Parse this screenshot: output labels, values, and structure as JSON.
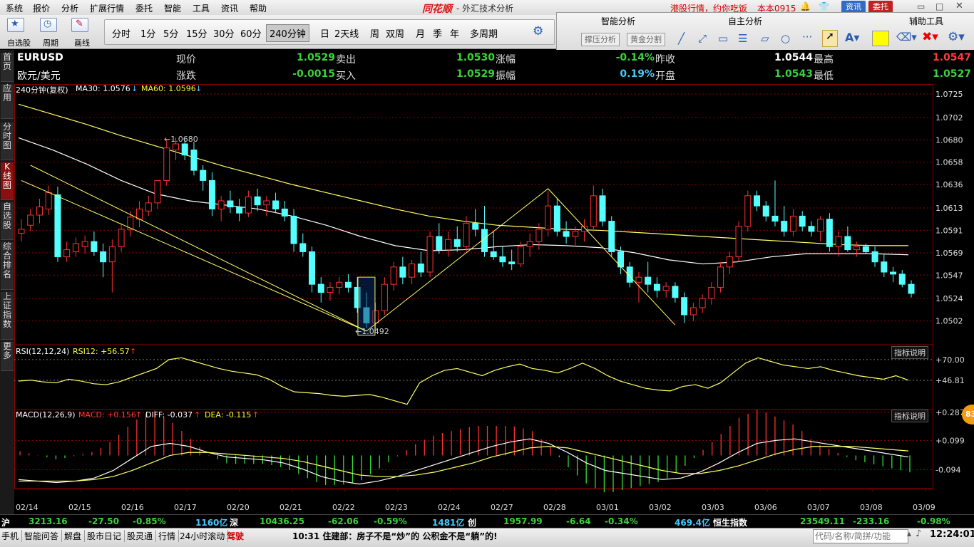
{
  "menu": [
    "系统",
    "报价",
    "分析",
    "扩展行情",
    "委托",
    "智能",
    "工具",
    "资讯",
    "帮助"
  ],
  "brand": "同花顺",
  "brand_sub": "- 外汇技术分析",
  "promo": "港股行情，约你吃饭",
  "account": "本本0915",
  "top_buttons": {
    "news": "资讯",
    "trade": "委托"
  },
  "toolbar": {
    "select_stock": "自选股",
    "period": "周期",
    "draw": "画线"
  },
  "periods": [
    "分时",
    "1分",
    "5分",
    "15分",
    "30分",
    "60分",
    "240分钟",
    "日",
    "2天线",
    "周",
    "双周",
    "月",
    "季",
    "年",
    "多周期"
  ],
  "analysis": {
    "smart": "智能分析",
    "selfselect": "自主分析",
    "aux": "辅助工具",
    "pressure_btn": "撑压分析",
    "golden_btn": "黄金分割"
  },
  "left_nav": [
    "首页",
    "应用",
    "分时图",
    "K线图",
    "自选股",
    "综合排名",
    "上证指数",
    "更多"
  ],
  "quote": {
    "code": "EURUSD",
    "name": "欧元/美元",
    "labels": {
      "now": "现价",
      "sell": "卖出",
      "change_pct": "涨幅",
      "prev_close": "昨收",
      "high": "最高",
      "change": "涨跌",
      "buy": "买入",
      "amplitude": "振幅",
      "open": "开盘",
      "low": "最低"
    },
    "now": "1.0529",
    "sell": "1.0530",
    "change_pct": "-0.14%",
    "prev_close": "1.0544",
    "high": "1.0547",
    "change": "-0.0015",
    "buy": "1.0529",
    "amplitude": "0.19%",
    "open": "1.0543",
    "low": "1.0527"
  },
  "indicators": {
    "main_title": "240分钟(复权)",
    "ma30": "MA30: 1.0576",
    "ma60": "MA60: 1.0596",
    "rsi_title": "RSI(12,12,24)",
    "rsi12": "RSI12: +56.57",
    "macd_title": "MACD(12,26,9)",
    "macd": "MACD: +0.156",
    "diff": "DIFF: -0.037",
    "dea": "DEA: -0.115",
    "explain": "指标说明",
    "high_label": "1.0680",
    "low_label": "1.0492",
    "badge": "83"
  },
  "chart_data": {
    "type": "candlestick",
    "price_axis": [
      "1.0725",
      "1.0702",
      "1.0680",
      "1.0658",
      "1.0636",
      "1.0613",
      "1.0591",
      "1.0569",
      "1.0547",
      "1.0524",
      "1.0502"
    ],
    "ylim": [
      1.048,
      1.0725
    ],
    "rsi_axis": [
      "+70.00",
      "+46.81"
    ],
    "rsi_ylim": [
      15,
      85
    ],
    "macd_axis": [
      "+0.287",
      "+0.099",
      "-0.094"
    ],
    "macd_ylim": [
      -0.22,
      0.3
    ],
    "dates": [
      "02/14",
      "02/15",
      "02/16",
      "02/17",
      "02/20",
      "02/21",
      "02/22",
      "02/23",
      "02/24",
      "02/27",
      "02/28",
      "03/01",
      "03/02",
      "03/03",
      "03/06",
      "03/07",
      "03/08",
      "03/09"
    ],
    "candles": [
      [
        1.0588,
        1.0602,
        1.058,
        1.0592
      ],
      [
        1.0596,
        1.0612,
        1.059,
        1.0606
      ],
      [
        1.0606,
        1.0622,
        1.0598,
        1.0614
      ],
      [
        1.0612,
        1.0635,
        1.0606,
        1.0628
      ],
      [
        1.0626,
        1.0634,
        1.056,
        1.0565
      ],
      [
        1.0565,
        1.058,
        1.056,
        1.0572
      ],
      [
        1.057,
        1.0584,
        1.0565,
        1.0578
      ],
      [
        1.0575,
        1.0586,
        1.0568,
        1.058
      ],
      [
        1.058,
        1.059,
        1.0566,
        1.057
      ],
      [
        1.057,
        1.0578,
        1.0545,
        1.056
      ],
      [
        1.056,
        1.0582,
        1.053,
        1.0575
      ],
      [
        1.0575,
        1.0598,
        1.057,
        1.0592
      ],
      [
        1.0592,
        1.061,
        1.0585,
        1.0604
      ],
      [
        1.0602,
        1.062,
        1.0594,
        1.0612
      ],
      [
        1.061,
        1.0625,
        1.0605,
        1.0618
      ],
      [
        1.0618,
        1.0632,
        1.0612,
        1.064
      ],
      [
        1.064,
        1.068,
        1.0635,
        1.0672
      ],
      [
        1.067,
        1.0682,
        1.066,
        1.0676
      ],
      [
        1.0676,
        1.068,
        1.066,
        1.0665
      ],
      [
        1.067,
        1.0678,
        1.0645,
        1.065
      ],
      [
        1.065,
        1.0655,
        1.063,
        1.064
      ],
      [
        1.064,
        1.0648,
        1.0605,
        1.0612
      ],
      [
        1.0612,
        1.0625,
        1.06,
        1.062
      ],
      [
        1.062,
        1.063,
        1.0608,
        1.0614
      ],
      [
        1.0614,
        1.0622,
        1.06,
        1.0608
      ],
      [
        1.0608,
        1.063,
        1.0604,
        1.0624
      ],
      [
        1.0624,
        1.0632,
        1.061,
        1.0616
      ],
      [
        1.0616,
        1.0625,
        1.0605,
        1.062
      ],
      [
        1.062,
        1.0628,
        1.0608,
        1.0612
      ],
      [
        1.0612,
        1.062,
        1.06,
        1.0605
      ],
      [
        1.0605,
        1.0612,
        1.057,
        1.0578
      ],
      [
        1.0578,
        1.0588,
        1.0565,
        1.057
      ],
      [
        1.057,
        1.0575,
        1.053,
        1.0538
      ],
      [
        1.0538,
        1.0545,
        1.052,
        1.053
      ],
      [
        1.053,
        1.054,
        1.0522,
        1.0535
      ],
      [
        1.0535,
        1.0545,
        1.0528,
        1.054
      ],
      [
        1.054,
        1.0548,
        1.053,
        1.0535
      ],
      [
        1.0535,
        1.0545,
        1.051,
        1.0515
      ],
      [
        1.0515,
        1.053,
        1.0495,
        1.05
      ],
      [
        1.05,
        1.052,
        1.0492,
        1.0512
      ],
      [
        1.0512,
        1.0545,
        1.0508,
        1.0538
      ],
      [
        1.0538,
        1.056,
        1.0532,
        1.0555
      ],
      [
        1.0555,
        1.0565,
        1.0538,
        1.0545
      ],
      [
        1.0545,
        1.0562,
        1.0538,
        1.0558
      ],
      [
        1.0558,
        1.057,
        1.0545,
        1.055
      ],
      [
        1.055,
        1.059,
        1.0545,
        1.0585
      ],
      [
        1.0585,
        1.0598,
        1.0568,
        1.0572
      ],
      [
        1.0572,
        1.059,
        1.0565,
        1.0582
      ],
      [
        1.0582,
        1.0595,
        1.057,
        1.0575
      ],
      [
        1.0575,
        1.0605,
        1.057,
        1.0598
      ],
      [
        1.0598,
        1.0612,
        1.0585,
        1.0592
      ],
      [
        1.0592,
        1.0615,
        1.0565,
        1.057
      ],
      [
        1.057,
        1.059,
        1.0562,
        1.0565
      ],
      [
        1.0565,
        1.0575,
        1.0555,
        1.056
      ],
      [
        1.056,
        1.0572,
        1.0552,
        1.0558
      ],
      [
        1.0558,
        1.058,
        1.0555,
        1.0575
      ],
      [
        1.0575,
        1.0588,
        1.0565,
        1.058
      ],
      [
        1.058,
        1.0598,
        1.0572,
        1.0592
      ],
      [
        1.0592,
        1.063,
        1.0585,
        1.0615
      ],
      [
        1.0615,
        1.0622,
        1.0585,
        1.059
      ],
      [
        1.059,
        1.06,
        1.0578,
        1.0585
      ],
      [
        1.0585,
        1.0595,
        1.0575,
        1.059
      ],
      [
        1.059,
        1.0602,
        1.058,
        1.0595
      ],
      [
        1.0595,
        1.0635,
        1.059,
        1.0625
      ],
      [
        1.0625,
        1.0632,
        1.0595,
        1.06
      ],
      [
        1.06,
        1.0605,
        1.0565,
        1.057
      ],
      [
        1.057,
        1.0575,
        1.0548,
        1.0555
      ],
      [
        1.0555,
        1.056,
        1.0535,
        1.054
      ],
      [
        1.054,
        1.055,
        1.052,
        1.0545
      ],
      [
        1.0545,
        1.056,
        1.053,
        1.0538
      ],
      [
        1.0538,
        1.0545,
        1.0525,
        1.0532
      ],
      [
        1.0532,
        1.054,
        1.0525,
        1.0536
      ],
      [
        1.0536,
        1.054,
        1.052,
        1.0525
      ],
      [
        1.0525,
        1.053,
        1.05,
        1.0508
      ],
      [
        1.0508,
        1.052,
        1.0502,
        1.0515
      ],
      [
        1.0515,
        1.0528,
        1.051,
        1.0524
      ],
      [
        1.0524,
        1.054,
        1.0518,
        1.0535
      ],
      [
        1.0535,
        1.056,
        1.053,
        1.0555
      ],
      [
        1.0555,
        1.057,
        1.0548,
        1.0565
      ],
      [
        1.0565,
        1.06,
        1.056,
        1.0595
      ],
      [
        1.0595,
        1.063,
        1.059,
        1.0625
      ],
      [
        1.0625,
        1.063,
        1.061,
        1.0615
      ],
      [
        1.0615,
        1.062,
        1.06,
        1.0605
      ],
      [
        1.0605,
        1.064,
        1.0595,
        1.06
      ],
      [
        1.06,
        1.0615,
        1.0585,
        1.059
      ],
      [
        1.059,
        1.0612,
        1.0585,
        1.0605
      ],
      [
        1.0605,
        1.061,
        1.059,
        1.0595
      ],
      [
        1.0595,
        1.06,
        1.0585,
        1.059
      ],
      [
        1.059,
        1.0605,
        1.058,
        1.0602
      ],
      [
        1.0602,
        1.0608,
        1.057,
        1.0575
      ],
      [
        1.0575,
        1.059,
        1.0565,
        1.0585
      ],
      [
        1.0585,
        1.0595,
        1.057,
        1.0572
      ],
      [
        1.0572,
        1.058,
        1.0565,
        1.0575
      ],
      [
        1.0575,
        1.0578,
        1.0568,
        1.057
      ],
      [
        1.057,
        1.0575,
        1.0555,
        1.056
      ],
      [
        1.056,
        1.0568,
        1.0545,
        1.055
      ],
      [
        1.055,
        1.0555,
        1.054,
        1.0548
      ],
      [
        1.0548,
        1.0552,
        1.0535,
        1.0538
      ],
      [
        1.0538,
        1.0542,
        1.0525,
        1.0529
      ]
    ],
    "ma30": [
      1.0715,
      1.0705,
      1.0695,
      1.0684,
      1.0674,
      1.0664,
      1.0654,
      1.0645,
      1.0636,
      1.0628,
      1.062,
      1.0612,
      1.0605,
      1.06,
      1.0596,
      1.0594,
      1.0592,
      1.0591,
      1.0589,
      1.0587,
      1.0585,
      1.0583,
      1.0581,
      1.0579,
      1.0577,
      1.0576,
      1.0576
    ],
    "ma60": [
      1.0682,
      1.067,
      1.0656,
      1.064,
      1.0627,
      1.062,
      1.0616,
      1.0612,
      1.0605,
      1.0596,
      1.0585,
      1.0576,
      1.0571,
      1.0572,
      1.0575,
      1.0577,
      1.0576,
      1.0574,
      1.0569,
      1.0562,
      1.0558,
      1.056,
      1.0565,
      1.0568,
      1.0568,
      1.0568,
      1.0567
    ],
    "trend_a": [
      [
        0,
        1.064
      ],
      [
        38,
        1.0492
      ],
      [
        58,
        1.0632
      ],
      [
        72,
        1.0498
      ]
    ],
    "trend_b": [
      [
        1,
        1.0655
      ],
      [
        38,
        1.0492
      ]
    ],
    "rsi12": [
      46,
      47,
      45,
      44,
      48,
      46,
      43,
      42,
      45,
      50,
      55,
      60,
      70,
      72,
      68,
      64,
      60,
      57,
      55,
      53,
      48,
      40,
      34,
      33,
      32,
      30,
      29,
      30,
      31,
      28,
      24,
      20,
      44,
      52,
      58,
      60,
      56,
      52,
      58,
      62,
      65,
      60,
      58,
      55,
      60,
      66,
      60,
      52,
      46,
      42,
      38,
      36,
      35,
      40,
      42,
      38,
      44,
      55,
      66,
      72,
      68,
      64,
      62,
      60,
      62,
      58,
      55,
      52,
      50,
      48,
      52,
      47
    ],
    "diff": [
      -0.16,
      -0.17,
      -0.18,
      -0.17,
      -0.15,
      -0.1,
      -0.02,
      0.06,
      0.08,
      0.06,
      0.02,
      -0.01,
      -0.02,
      -0.03,
      -0.05,
      -0.09,
      -0.14,
      -0.17,
      -0.19,
      -0.17,
      -0.14,
      -0.1,
      -0.06,
      -0.02,
      0.02,
      0.06,
      0.09,
      0.11,
      0.08,
      0.02,
      -0.05,
      -0.1,
      -0.12,
      -0.14,
      -0.16,
      -0.15,
      -0.11,
      -0.05,
      0.02,
      0.08,
      0.1,
      0.11,
      0.09,
      0.07,
      0.05,
      0.03,
      0.01,
      -0.01
    ],
    "dea": [
      -0.17,
      -0.17,
      -0.17,
      -0.17,
      -0.16,
      -0.14,
      -0.1,
      -0.05,
      0.0,
      0.02,
      0.02,
      0.01,
      0.0,
      -0.01,
      -0.02,
      -0.04,
      -0.07,
      -0.1,
      -0.13,
      -0.14,
      -0.14,
      -0.13,
      -0.11,
      -0.08,
      -0.05,
      -0.01,
      0.02,
      0.05,
      0.06,
      0.05,
      0.02,
      -0.01,
      -0.04,
      -0.07,
      -0.1,
      -0.12,
      -0.12,
      -0.1,
      -0.07,
      -0.03,
      0.01,
      0.04,
      0.06,
      0.06,
      0.06,
      0.05,
      0.04,
      0.03
    ]
  },
  "ticker": [
    {
      "label": "沪",
      "value": "3213.16",
      "chg": "-27.50",
      "pct": "-0.85%",
      "vol": "1160亿"
    },
    {
      "label": "深",
      "value": "10436.25",
      "chg": "-62.06",
      "pct": "-0.59%",
      "vol": "1481亿"
    },
    {
      "label": "创",
      "value": "1957.99",
      "chg": "-6.64",
      "pct": "-0.34%",
      "vol": "469.4亿"
    },
    {
      "label": "恒生指数",
      "value": "23549.11",
      "chg": "-233.16",
      "pct": "-0.98%"
    }
  ],
  "bottom": {
    "items": [
      "手机",
      "智能问答",
      "解盘",
      "股市日记",
      "股灵通",
      "行情",
      "24小时滚动"
    ],
    "tag": "驾驶",
    "news": "10:31 住建部：房子不是“炒”的 公积金不是“躺”的!",
    "search_placeholder": "代码/名称/简拼/功能",
    "clock": "12:24:01"
  },
  "colors": {
    "up": "#ff3030",
    "down": "#54ffff",
    "ma30": "#ffff66",
    "ma60": "#ffffff",
    "grid": "#8a0000"
  }
}
